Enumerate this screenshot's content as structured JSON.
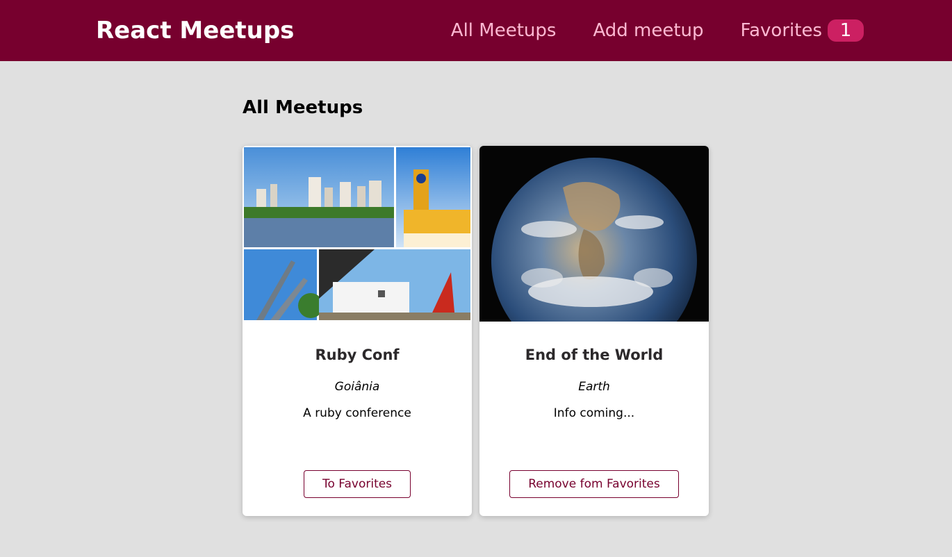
{
  "header": {
    "logo": "React Meetups",
    "nav": {
      "all": "All Meetups",
      "add": "Add meetup",
      "favorites": "Favorites",
      "favorites_count": "1"
    }
  },
  "main": {
    "title": "All Meetups",
    "meetups": [
      {
        "title": "Ruby Conf",
        "address": "Goiânia",
        "description": "A ruby conference",
        "action": "To Favorites"
      },
      {
        "title": "End of the World",
        "address": "Earth",
        "description": "Info coming...",
        "action": "Remove fom Favorites"
      }
    ]
  },
  "colors": {
    "header_bg": "#77002e",
    "nav_link": "#fcb8d2",
    "badge_bg": "#cc2062",
    "page_bg": "#e0e0e0"
  }
}
